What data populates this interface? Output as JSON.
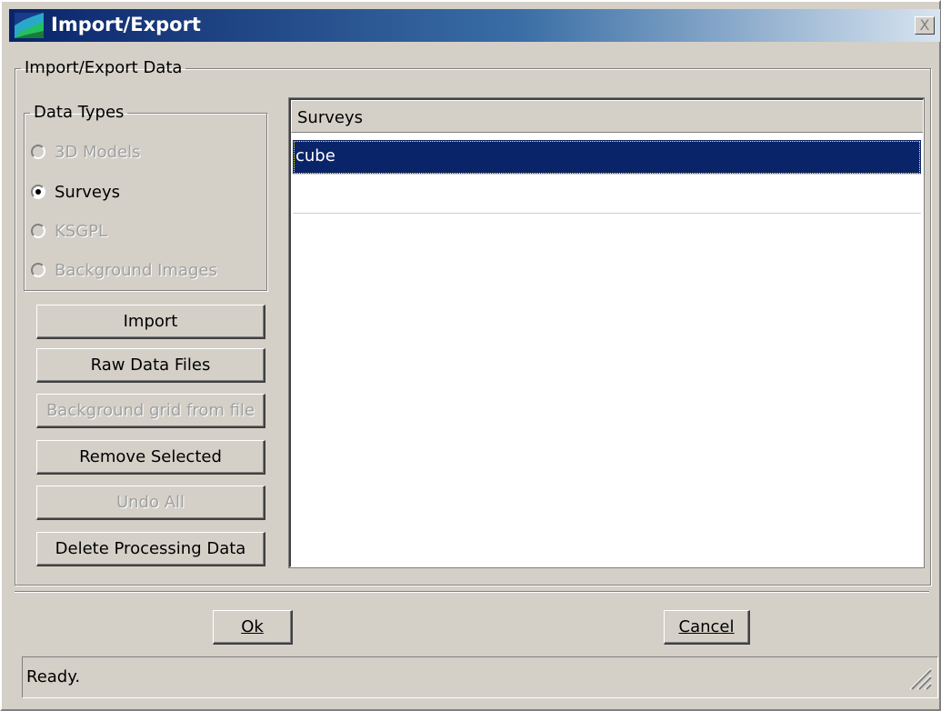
{
  "window": {
    "title": "Import/Export",
    "close_label": "X"
  },
  "group": {
    "legend": "Import/Export Data"
  },
  "data_types": {
    "legend": "Data Types",
    "options": [
      {
        "label": "3D Models",
        "enabled": false,
        "selected": false
      },
      {
        "label": "Surveys",
        "enabled": true,
        "selected": true
      },
      {
        "label": "KSGPL",
        "enabled": false,
        "selected": false
      },
      {
        "label": "Background Images",
        "enabled": false,
        "selected": false
      }
    ]
  },
  "actions": [
    {
      "label": "Import",
      "enabled": true
    },
    {
      "label": "Raw Data Files",
      "enabled": true
    },
    {
      "label": "Background grid from file",
      "enabled": false
    },
    {
      "label": "Remove Selected",
      "enabled": true
    },
    {
      "label": "Undo All",
      "enabled": false
    },
    {
      "label": "Delete Processing Data",
      "enabled": true
    }
  ],
  "list": {
    "header": "Surveys",
    "rows": [
      "cube"
    ],
    "selected_index": 0
  },
  "footer": {
    "ok_label": "Ok",
    "cancel_label": "Cancel"
  },
  "status": {
    "text": "Ready."
  },
  "colors": {
    "face": "#d4d0c8",
    "title_start": "#0a246a",
    "title_end": "#d8e4f0",
    "selection": "#0a246a",
    "disabled_text": "#a0a0a0"
  }
}
